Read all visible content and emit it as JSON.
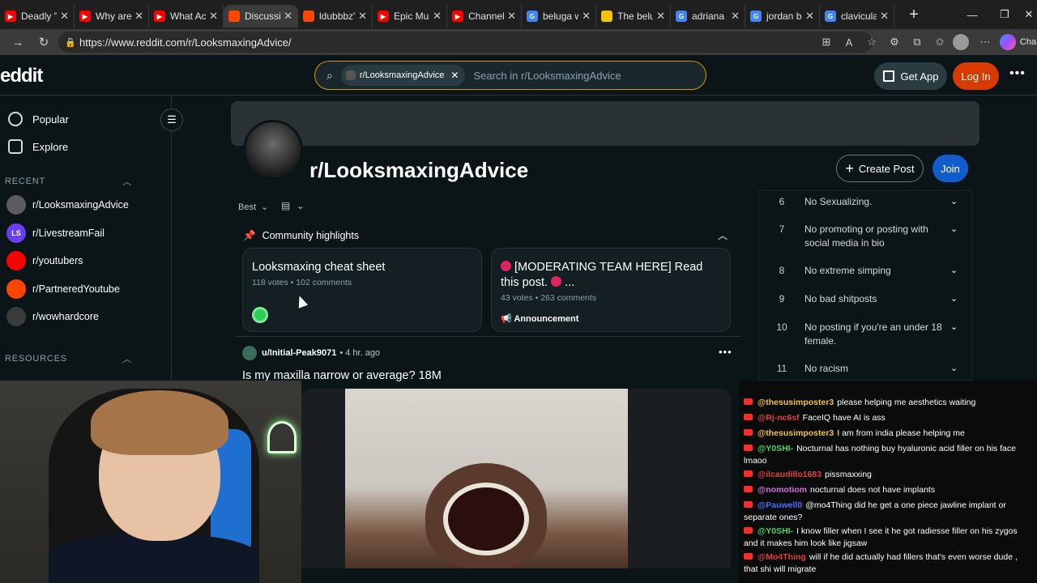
{
  "browser": {
    "tabs": [
      {
        "title": "Deadly \"E",
        "icon": "youtube-icon",
        "color": "#ff0000"
      },
      {
        "title": "Why are I",
        "icon": "youtube-icon",
        "color": "#ff0000"
      },
      {
        "title": "What Act",
        "icon": "youtube-icon",
        "color": "#ff0000"
      },
      {
        "title": "Discussio",
        "icon": "reddit-icon",
        "color": "#ff4500",
        "active": true
      },
      {
        "title": "ldubbbz's",
        "icon": "reddit-icon",
        "color": "#ff4500"
      },
      {
        "title": "Epic Musi",
        "icon": "youtube-icon",
        "color": "#ff0000"
      },
      {
        "title": "Channel c",
        "icon": "youtube-icon",
        "color": "#ff0000"
      },
      {
        "title": "beluga w",
        "icon": "google-icon",
        "color": "#4285f4"
      },
      {
        "title": "The belu",
        "icon": "page-icon",
        "color": "#f5c400"
      },
      {
        "title": "adriana li",
        "icon": "google-icon",
        "color": "#4285f4"
      },
      {
        "title": "jordan ba",
        "icon": "google-icon",
        "color": "#4285f4"
      },
      {
        "title": "clavicular",
        "icon": "google-icon",
        "color": "#4285f4"
      }
    ],
    "url": "https://www.reddit.com/r/LooksmaxingAdvice/",
    "copilot_label": "Cha"
  },
  "header": {
    "logo": "eddit",
    "search_chip": "r/LooksmaxingAdvice",
    "search_placeholder": "Search in r/LooksmaxingAdvice",
    "get_app": "Get App",
    "login": "Log In",
    "accent": "#d93a00"
  },
  "sidebar": {
    "nav": [
      {
        "label": "Popular",
        "icon": "popular-icon"
      },
      {
        "label": "Explore",
        "icon": "explore-icon"
      }
    ],
    "recent_title": "RECENT",
    "recent": [
      {
        "label": "r/LooksmaxingAdvice",
        "color": "#5b5b5b"
      },
      {
        "label": "r/LivestreamFail",
        "color": "#6a3df0",
        "mark": "LS"
      },
      {
        "label": "r/youtubers",
        "color": "#ff0000"
      },
      {
        "label": "r/PartneredYoutube",
        "color": "#ff4500"
      },
      {
        "label": "r/wowhardcore",
        "color": "#3a3a3a"
      }
    ],
    "resources_title": "RESOURCES"
  },
  "subreddit": {
    "name": "r/LooksmaxingAdvice",
    "create_post": "Create Post",
    "join": "Join",
    "sort": "Best",
    "highlights_title": "Community highlights",
    "cards": [
      {
        "title": "Looksmaxing cheat sheet",
        "meta": "118 votes • 102 comments"
      },
      {
        "title": "[MODERATING TEAM HERE] Read this post.",
        "title_tail": "...",
        "meta": "43 votes • 263 comments",
        "tag": "Announcement"
      }
    ]
  },
  "post": {
    "user": "u/Initial-Peak9071",
    "time": "• 4 hr. ago",
    "title": "Is my maxilla narrow or average? 18M"
  },
  "rules": [
    {
      "num": "6",
      "text": "No Sexualizing."
    },
    {
      "num": "7",
      "text": "No promoting or posting with social media in bio"
    },
    {
      "num": "8",
      "text": "No extreme simping"
    },
    {
      "num": "9",
      "text": "No bad shitposts"
    },
    {
      "num": "10",
      "text": "No posting if you're an under 18 female."
    },
    {
      "num": "11",
      "text": "No racism"
    }
  ],
  "chat": [
    {
      "user": "@thesusimposter3",
      "color": "#f0c040",
      "msg": "please helping me aesthetics waiting"
    },
    {
      "user": "@Rj-nc6sf",
      "color": "#e04040",
      "msg": "FaceIQ have AI is ass"
    },
    {
      "user": "@thesusimposter3",
      "color": "#f0c040",
      "msg": "I am from india please helping me"
    },
    {
      "user": "@Y0SHI-",
      "color": "#4bd46b",
      "msg": "Nocturnal has nothing buy hyaluronic acid filler on his face lmaoo"
    },
    {
      "user": "@ilcaudillo1683",
      "color": "#e04040",
      "msg": "pissmaxxing"
    },
    {
      "user": "@nomotiom",
      "color": "#d070e0",
      "msg": "nocturnal does not have implants"
    },
    {
      "user": "@Pauwell0",
      "color": "#4c6cff",
      "msg": "@mo4Thing did he get a one piece jawline implant or separate ones?"
    },
    {
      "user": "@Y0SHI-",
      "color": "#4bd46b",
      "msg": "I know filler when I see it he got radiesse filler on his zygos and it makes him look like jigsaw"
    },
    {
      "user": "@Mo4Thing",
      "color": "#e04040",
      "msg": "will if he did actually had fillers that's even worse dude , that shi will migrate"
    }
  ]
}
